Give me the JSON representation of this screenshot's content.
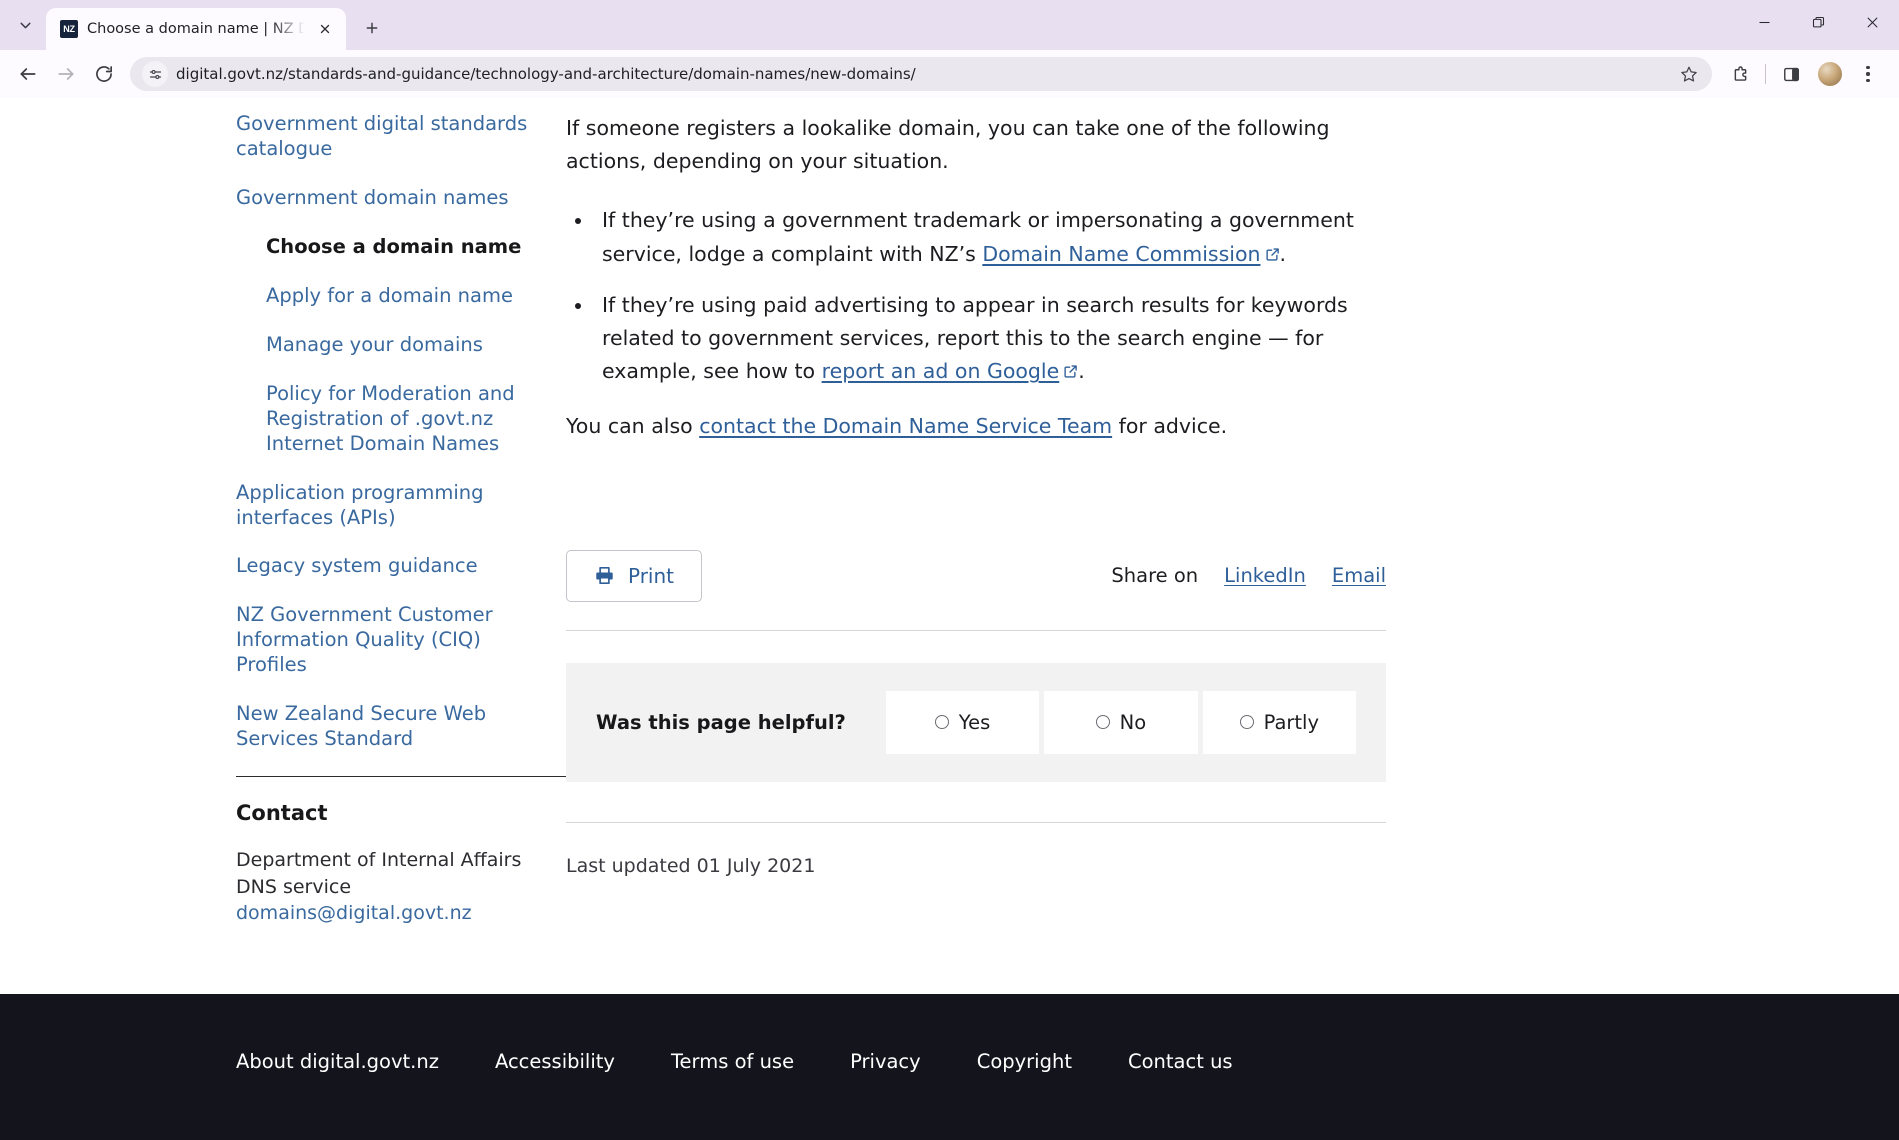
{
  "browser": {
    "tab": {
      "title": "Choose a domain name | NZ Di",
      "favicon_label": "NZ",
      "favicon_icon": "nz-logo-icon"
    },
    "new_tab_tooltip": "New tab",
    "url": "digital.govt.nz/standards-and-guidance/technology-and-architecture/domain-names/new-domains/",
    "icons": {
      "tab_search": "chevron-down-icon",
      "back": "back-arrow-icon",
      "forward": "forward-arrow-icon",
      "reload": "reload-icon",
      "site_info": "site-settings-icon",
      "bookmark": "star-icon",
      "extensions": "extensions-puzzle-icon",
      "side_panel": "side-panel-icon",
      "profile": "avatar-icon",
      "menu": "three-dots-menu-icon",
      "minimize": "minimize-icon",
      "maximize": "restore-icon",
      "close": "close-icon"
    }
  },
  "sidebar": {
    "items": [
      {
        "label": "Government digital standards catalogue",
        "level": 0,
        "current": false
      },
      {
        "label": "Government domain names",
        "level": 0,
        "current": false
      },
      {
        "label": "Choose a domain name",
        "level": 1,
        "current": true
      },
      {
        "label": "Apply for a domain name",
        "level": 1,
        "current": false
      },
      {
        "label": "Manage your domains",
        "level": 1,
        "current": false
      },
      {
        "label": "Policy for Moderation and Registration of .govt.nz Internet Domain Names",
        "level": 1,
        "current": false
      },
      {
        "label": "Application programming interfaces (APIs)",
        "level": 0,
        "current": false
      },
      {
        "label": "Legacy system guidance",
        "level": 0,
        "current": false
      },
      {
        "label": "NZ Government Customer Information Quality (CIQ) Profiles",
        "level": 0,
        "current": false
      },
      {
        "label": "New Zealand Secure Web Services Standard",
        "level": 0,
        "current": false
      }
    ],
    "contact": {
      "heading": "Contact",
      "line1": "Department of Internal Affairs",
      "line2": "DNS service",
      "email": "domains@digital.govt.nz"
    }
  },
  "content": {
    "intro": "If someone registers a lookalike domain, you can take one of the following actions, depending on your situation.",
    "bullet1": {
      "before": "If they’re using a government trademark or impersonating a government service, lodge a complaint with NZ’s ",
      "link": "Domain Name Commission",
      "after": "."
    },
    "bullet2": {
      "before": "If they’re using paid advertising to appear in search results for keywords related to government services, report this to the search engine — for example, see how to ",
      "link": "report an ad on Google",
      "after": "."
    },
    "closing": {
      "before": "You can also ",
      "link": "contact the Domain Name Service Team",
      "after": " for advice."
    },
    "print_label": "Print",
    "share_label": "Share on",
    "share_links": [
      "LinkedIn",
      "Email"
    ],
    "feedback": {
      "question": "Was this page helpful?",
      "options": [
        "Yes",
        "No",
        "Partly"
      ]
    },
    "last_updated": "Last updated 01 July 2021"
  },
  "footer": {
    "links": [
      "About digital.govt.nz",
      "Accessibility",
      "Terms of use",
      "Privacy",
      "Copyright",
      "Contact us"
    ]
  },
  "colors": {
    "link": "#2f5f99",
    "sidebar_link": "#39699e",
    "tabstrip": "#e8dff1",
    "footer_bg": "#14141c",
    "feedback_bg": "#f2f2f3"
  }
}
